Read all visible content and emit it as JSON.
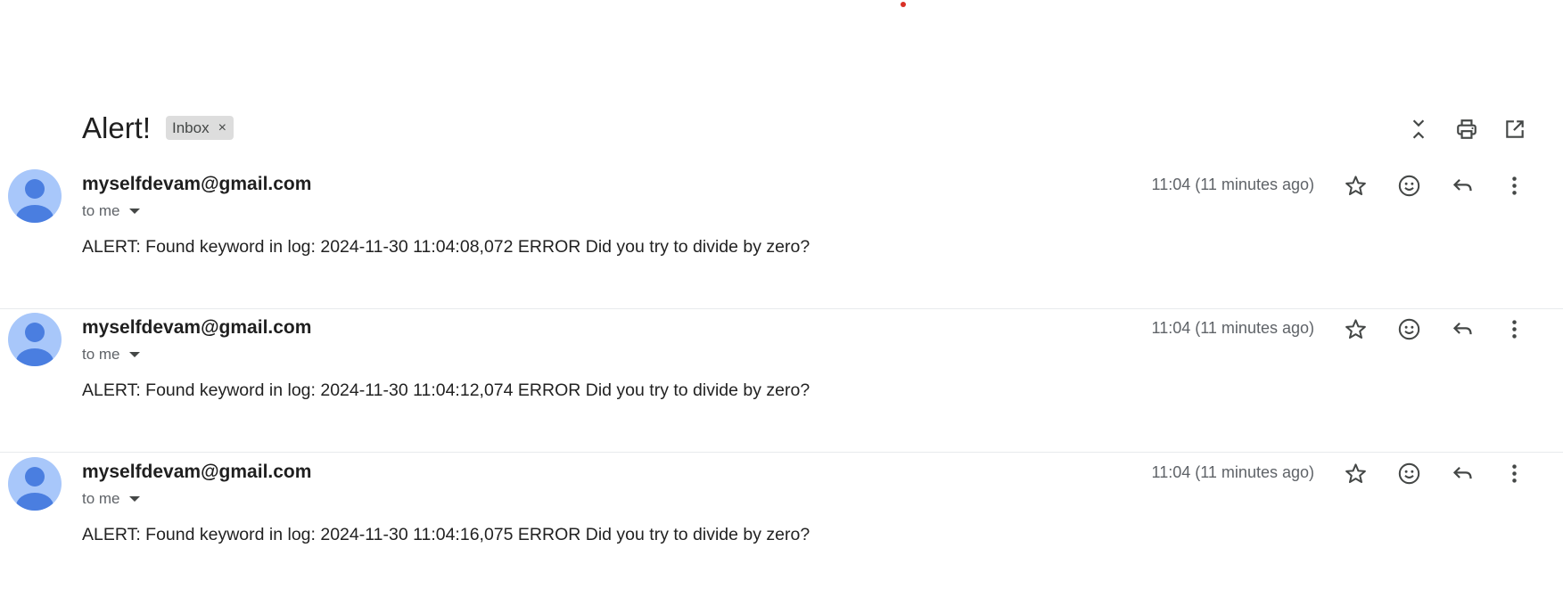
{
  "thread": {
    "subject": "Alert!",
    "label": "Inbox",
    "label_remove_glyph": "×",
    "actions": [
      "collapse-all-icon",
      "print-icon",
      "open-in-new-window-icon"
    ]
  },
  "messages": [
    {
      "sender": "myselfdevam@gmail.com",
      "recipient": "to me",
      "time": "11:04 (11 minutes ago)",
      "body": "ALERT: Found keyword in log: 2024-11-30 11:04:08,072 ERROR Did you try to divide by zero?"
    },
    {
      "sender": "myselfdevam@gmail.com",
      "recipient": "to me",
      "time": "11:04 (11 minutes ago)",
      "body": "ALERT: Found keyword in log: 2024-11-30 11:04:12,074 ERROR Did you try to divide by zero?"
    },
    {
      "sender": "myselfdevam@gmail.com",
      "recipient": "to me",
      "time": "11:04 (11 minutes ago)",
      "body": "ALERT: Found keyword in log: 2024-11-30 11:04:16,075 ERROR Did you try to divide by zero?"
    }
  ],
  "message_actions": [
    "star-icon",
    "emoji-reaction-icon",
    "reply-icon",
    "more-vert-icon"
  ],
  "colors": {
    "avatar_bg": "#a8c7fa",
    "avatar_fg": "#4a7ee0",
    "icon": "#444746",
    "chip_bg": "#dddddd",
    "notification_dot": "#d93025"
  }
}
